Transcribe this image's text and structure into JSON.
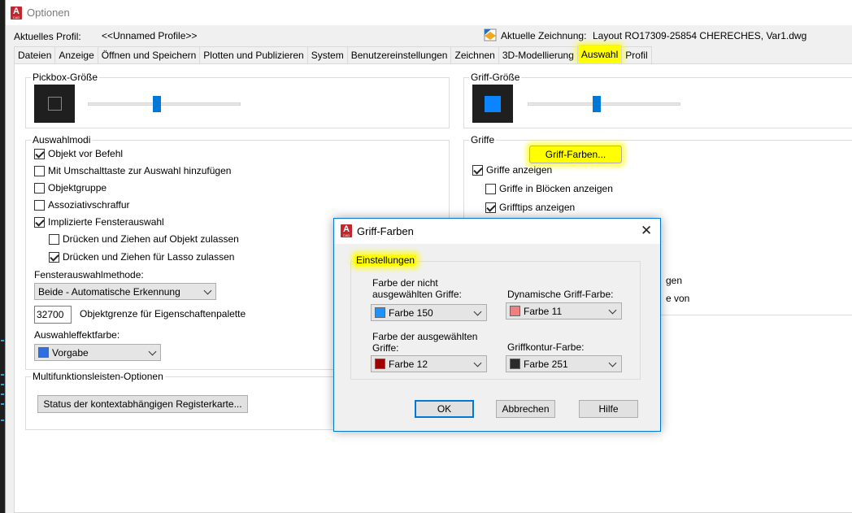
{
  "window": {
    "title": "Optionen"
  },
  "profile": {
    "label": "Aktuelles Profil:",
    "value": "<<Unnamed Profile>>"
  },
  "drawing": {
    "label": "Aktuelle Zeichnung:",
    "value": "Layout RO17309-25854 CHERECHES, Var1.dwg"
  },
  "tabs": [
    {
      "label": "Dateien"
    },
    {
      "label": "Anzeige"
    },
    {
      "label": "Öffnen und Speichern"
    },
    {
      "label": "Plotten und Publizieren"
    },
    {
      "label": "System"
    },
    {
      "label": "Benutzereinstellungen"
    },
    {
      "label": "Zeichnen"
    },
    {
      "label": "3D-Modellierung"
    },
    {
      "label": "Auswahl",
      "active": true
    },
    {
      "label": "Profil"
    }
  ],
  "pickbox": {
    "title": "Pickbox-Größe",
    "slider_fraction": 0.45,
    "preview_color": "#22cc22"
  },
  "grip_size": {
    "title": "Griff-Größe",
    "slider_fraction": 0.45,
    "preview_color": "#0a84ff"
  },
  "selection_modes": {
    "title": "Auswahlmodi",
    "items": [
      {
        "label": "Objekt vor Befehl",
        "checked": true
      },
      {
        "label": "Mit Umschalttaste zur Auswahl hinzufügen",
        "checked": false
      },
      {
        "label": "Objektgruppe",
        "checked": false
      },
      {
        "label": "Assoziativschraffur",
        "checked": false
      },
      {
        "label": "Implizierte Fensterauswahl",
        "checked": true
      },
      {
        "label": "Drücken und Ziehen auf Objekt zulassen",
        "checked": false
      },
      {
        "label": "Drücken und Ziehen für Lasso zulassen",
        "checked": true
      }
    ],
    "window_method_label": "Fensterauswahlmethode:",
    "window_method_value": "Beide - Automatische Erkennung",
    "object_limit_value": "32700",
    "object_limit_label": "Objektgrenze für Eigenschaftenpalette",
    "effect_color_label": "Auswahleffektfarbe:",
    "effect_color_value": "Vorgabe",
    "effect_color_swatch": "#2f6fe0"
  },
  "ribbon": {
    "title": "Multifunktionsleisten-Optionen",
    "button": "Status der kontextabhängigen Registerkarte..."
  },
  "grips": {
    "title": "Griffe",
    "colors_button": "Griff-Farben...",
    "items": [
      {
        "label": "Griffe anzeigen",
        "checked": true
      },
      {
        "label": "Griffe in Blöcken anzeigen",
        "checked": false
      },
      {
        "label": "Grifftips anzeigen",
        "checked": true
      }
    ],
    "partial_text_1": "gen",
    "partial_text_2": "e von"
  },
  "dialog": {
    "title": "Griff-Farben",
    "group_title": "Einstellungen",
    "unselected_label": "Farbe der nicht ausgewählten Griffe:",
    "unselected_value": "Farbe 150",
    "unselected_color": "#1e90ff",
    "dynamic_label": "Dynamische Griff-Farbe:",
    "dynamic_value": "Farbe 11",
    "dynamic_color": "#f08080",
    "selected_label": "Farbe der ausgewählten Griffe:",
    "selected_value": "Farbe 12",
    "selected_color": "#a00000",
    "outline_label": "Griffkontur-Farbe:",
    "outline_value": "Farbe 251",
    "outline_color": "#2b2b2b",
    "ok": "OK",
    "cancel": "Abbrechen",
    "help": "Hilfe"
  }
}
